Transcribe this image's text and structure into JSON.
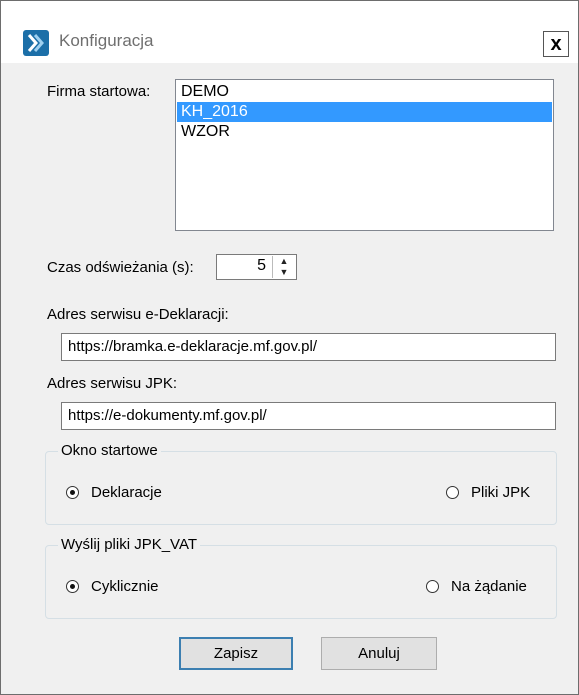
{
  "window": {
    "title": "Konfiguracja",
    "close_label": "x"
  },
  "company": {
    "label": "Firma startowa:",
    "items": [
      "DEMO",
      "KH_2016",
      "WZOR"
    ],
    "selected_index": 1
  },
  "refresh": {
    "label": "Czas odświeżania (s):",
    "value": "5"
  },
  "edeklaracje": {
    "label": "Adres serwisu e-Deklaracji:",
    "value": "https://bramka.e-deklaracje.mf.gov.pl/"
  },
  "jpk": {
    "label": "Adres serwisu JPK:",
    "value": "https://e-dokumenty.mf.gov.pl/"
  },
  "start_window": {
    "title": "Okno startowe",
    "options": [
      "Deklaracje",
      "Pliki JPK"
    ],
    "selected": "Deklaracje"
  },
  "send_jpk": {
    "title": "Wyślij pliki JPK_VAT",
    "options": [
      "Cyklicznie",
      "Na żądanie"
    ],
    "selected": "Cyklicznie"
  },
  "buttons": {
    "save": "Zapisz",
    "cancel": "Anuluj"
  },
  "icons": {
    "app": "app-logo-icon",
    "close": "close-icon",
    "spin_up": "chevron-up-icon",
    "spin_down": "chevron-down-icon"
  },
  "colors": {
    "selection": "#3399ff",
    "dialog_bg": "#f0f0f0",
    "accent": "#1c6fa8"
  }
}
